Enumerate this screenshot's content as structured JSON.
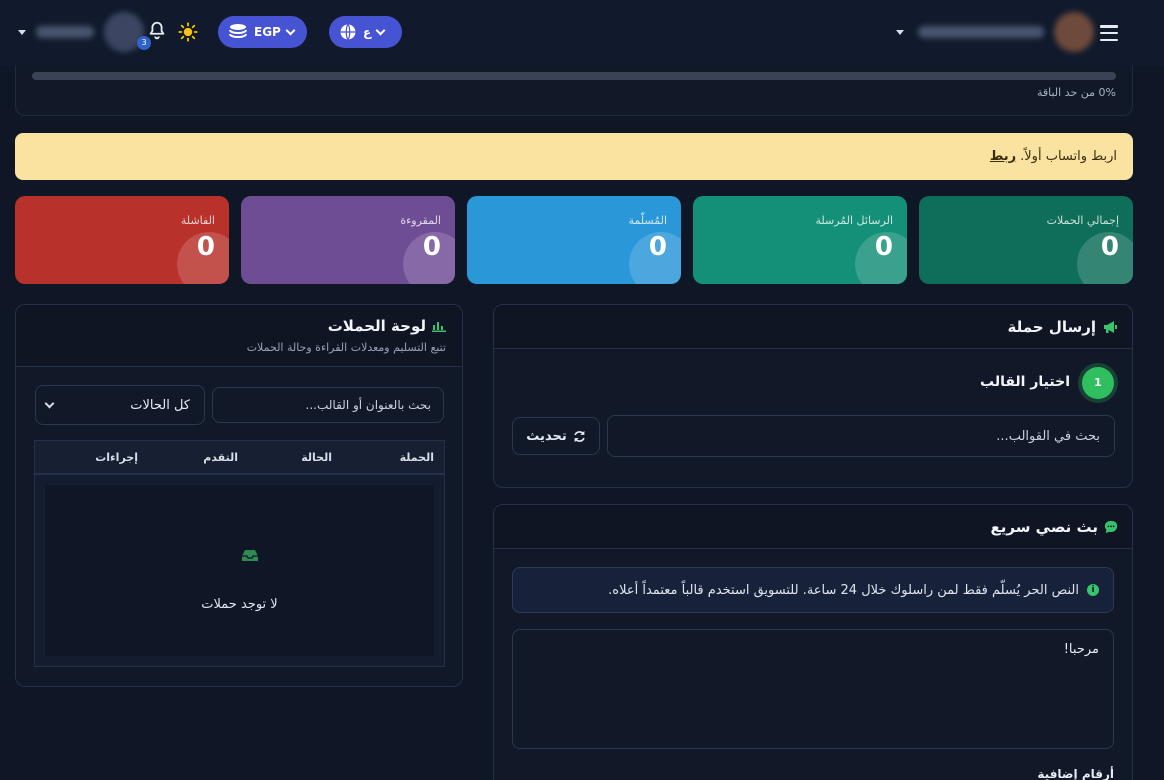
{
  "header": {
    "notifications_count": "3",
    "currency": "EGP",
    "language": "ع",
    "icons": [
      "caret-down-icon",
      "bell-icon",
      "sun-icon",
      "coins-icon",
      "globe-icon",
      "menu-icon"
    ]
  },
  "usage": {
    "text": "0% من حد الباقة",
    "percent": 0
  },
  "alert": {
    "text": "اربط واتساب أولاً.",
    "link": "ربط"
  },
  "stats": [
    {
      "label": "إجمالي الحملات",
      "value": "0",
      "color": "#0e6e5a"
    },
    {
      "label": "الرسائل المُرسلة",
      "value": "0",
      "color": "#148f78"
    },
    {
      "label": "المُسلّمة",
      "value": "0",
      "color": "#2a97d8"
    },
    {
      "label": "المقروءة",
      "value": "0",
      "color": "#6f4d95"
    },
    {
      "label": "الفاشلة",
      "value": "0",
      "color": "#b8312a"
    }
  ],
  "board": {
    "title": "لوحة الحملات",
    "subtitle": "تتبع التسليم ومعدلات القراءة وحالة الحملات",
    "search_placeholder": "بحث بالعنوان أو القالب...",
    "filter_selected": "كل الحالات",
    "columns": [
      "الحملة",
      "الحالة",
      "التقدم",
      "إجراءات"
    ],
    "empty": "لا توجد حملات"
  },
  "send": {
    "title": "إرسال حملة",
    "step_number": "1",
    "step_title": "اختيار القالب",
    "search_placeholder": "بحث في القوالب...",
    "refresh_label": "تحديث"
  },
  "quick": {
    "title": "بث نصي سريع",
    "info": "النص الحر يُسلّم فقط لمن راسلوك خلال 24 ساعة. للتسويق استخدم قالباً معتمداً أعلاه.",
    "message": "مرحبا!",
    "extra_label": "أرقام إضافية"
  }
}
